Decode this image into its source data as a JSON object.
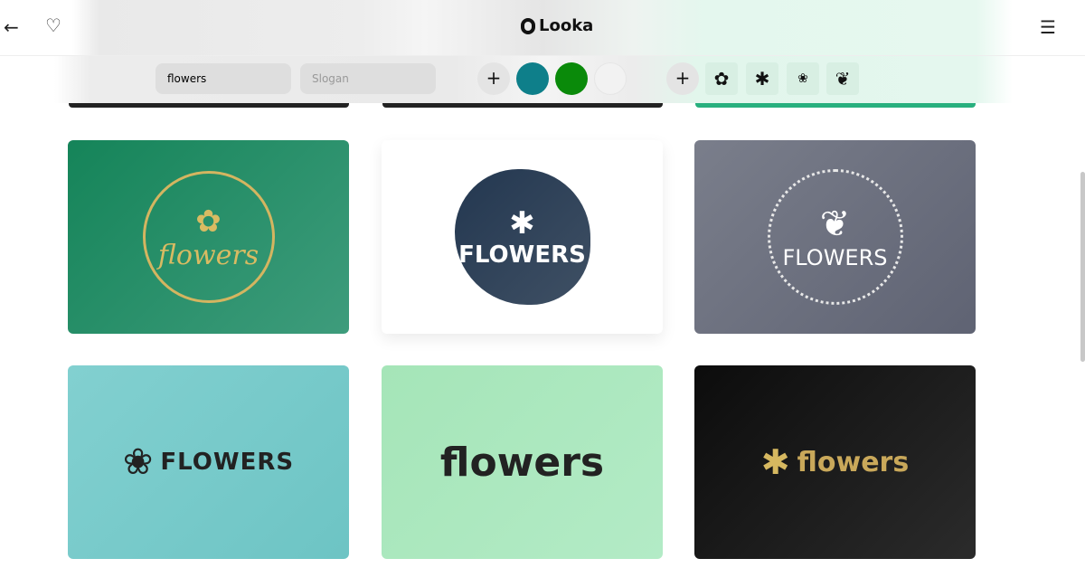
{
  "header": {
    "brand": "Looka",
    "back_icon": "arrow-left-icon",
    "favorite_icon": "heart-icon",
    "menu_icon": "hamburger-menu-icon"
  },
  "toolbar": {
    "name_value": "flowers",
    "slogan_placeholder": "Slogan",
    "colors": [
      "#0e7f8a",
      "#0a8a0a",
      "#f2f2f2"
    ],
    "symbols": [
      "flower-icon",
      "star-flower-icon",
      "rose-outline-icon",
      "rose-icon"
    ]
  },
  "cards": [
    {
      "text": "flowers",
      "bg": "#1f8c65",
      "icon": "flower-icon"
    },
    {
      "text": "FLOWERS",
      "bg": "#ffffff",
      "icon": "star-flower-icon"
    },
    {
      "text": "FLOWERS",
      "bg": "#6d7180",
      "icon": "rose-icon"
    },
    {
      "text": "FLOWERS",
      "bg": "#79cbcb",
      "icon": "rose-outline-icon"
    },
    {
      "text": "flowers",
      "bg": "#aee8bf"
    },
    {
      "text": "flowers",
      "bg": "#151515",
      "icon": "star-flower-icon"
    }
  ]
}
